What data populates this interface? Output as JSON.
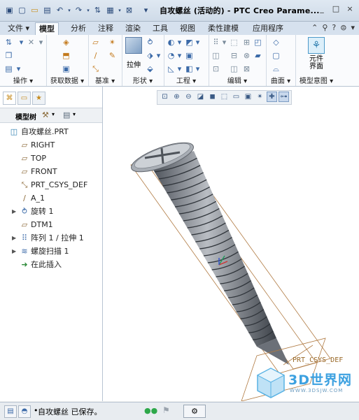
{
  "window": {
    "title": "自攻螺丝 (活动的) - PTC Creo Parame...",
    "controls": [
      "?",
      "□",
      "×"
    ]
  },
  "tabs": [
    {
      "label": "文件",
      "has_menu": true
    },
    {
      "label": "模型",
      "active": true
    },
    {
      "label": "分析"
    },
    {
      "label": "注释"
    },
    {
      "label": "渲染"
    },
    {
      "label": "工具"
    },
    {
      "label": "视图"
    },
    {
      "label": "柔性建模"
    },
    {
      "label": "应用程序"
    }
  ],
  "ribbon": {
    "groups": [
      {
        "label": "操作"
      },
      {
        "label": "获取数据"
      },
      {
        "label": "基准"
      },
      {
        "label": "形状"
      },
      {
        "label": "工程"
      },
      {
        "label": "编辑"
      },
      {
        "label": "曲面"
      },
      {
        "label": "模型意图"
      }
    ],
    "extrude_label": "拉伸",
    "component_interface_label": "元件界面"
  },
  "panel": {
    "tree_label": "模型树",
    "items": [
      {
        "label": "自攻螺丝.PRT",
        "icon": "part-icon",
        "expandable": false
      },
      {
        "label": "RIGHT",
        "icon": "datum-plane-icon",
        "expandable": false
      },
      {
        "label": "TOP",
        "icon": "datum-plane-icon",
        "expandable": false
      },
      {
        "label": "FRONT",
        "icon": "datum-plane-icon",
        "expandable": false
      },
      {
        "label": "PRT_CSYS_DEF",
        "icon": "csys-icon",
        "expandable": false
      },
      {
        "label": "A_1",
        "icon": "datum-axis-icon",
        "expandable": false
      },
      {
        "label": "旋转 1",
        "icon": "revolve-icon",
        "expandable": true
      },
      {
        "label": "DTM1",
        "icon": "datum-plane-icon",
        "expandable": false
      },
      {
        "label": "阵列 1 / 拉伸 1",
        "icon": "pattern-icon",
        "expandable": true
      },
      {
        "label": "螺旋扫描 1",
        "icon": "helical-sweep-icon",
        "expandable": true
      },
      {
        "label": "在此插入",
        "icon": "insert-here-icon",
        "expandable": false
      }
    ]
  },
  "viewport": {
    "csys_label": "PRT_CSYS_DEF"
  },
  "status": {
    "message": "自攻螺丝 已保存。"
  },
  "watermark": {
    "text": "3D世界网",
    "sub": "WWW.3DSJW.COM"
  }
}
